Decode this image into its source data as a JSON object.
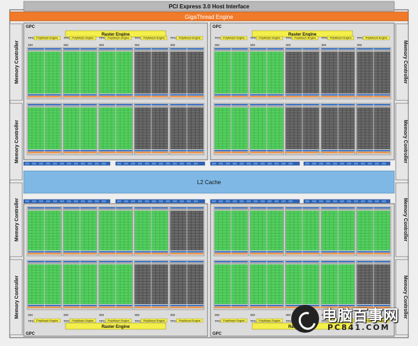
{
  "diagram": {
    "pcie_label": "PCI Express 3.0 Host Interface",
    "gigathread_label": "GigaThread Engine",
    "l2_label": "L2 Cache",
    "gpc_label": "GPC",
    "raster_label": "Raster Engine",
    "tpc_label": "TPC",
    "polymorph_label": "PolyMorph Engine",
    "sm_label": "SM",
    "memctrl_label": "Memory Controller",
    "gpc_count": 4,
    "tpcs_per_gpc": 5,
    "sms_per_tpc": 2,
    "colors": {
      "pcie_bar": "#b9b9b9",
      "gigathread_bar": "#f07a2a",
      "raster_bar": "#f5ef4a",
      "l2_cache": "#7fb8e4",
      "core_green": "#3fb24a",
      "core_dark": "#4a4a4a",
      "sm_blue": "#3f74c5",
      "sm_orange": "#f08a32",
      "frame": "#555555"
    }
  },
  "watermark": {
    "text": "电脑百事网",
    "url": "PC841.COM"
  }
}
